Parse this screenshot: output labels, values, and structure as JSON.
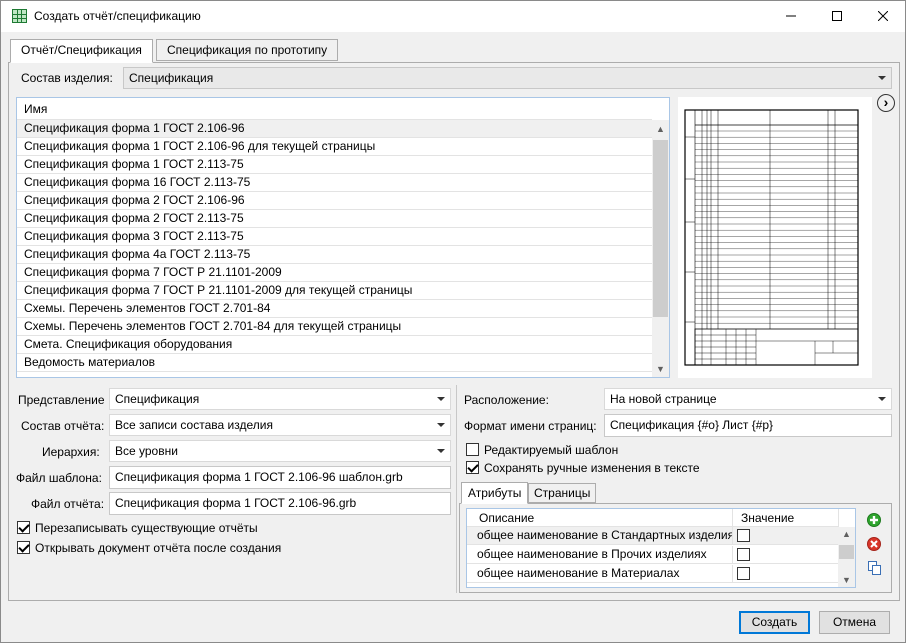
{
  "window": {
    "title": "Создать отчёт/спецификацию",
    "minimize": "—",
    "maximize": "☐",
    "close": "✕"
  },
  "tabs": [
    {
      "label": "Отчёт/Спецификация",
      "active": true
    },
    {
      "label": "Спецификация по прототипу",
      "active": false
    }
  ],
  "composition": {
    "label": "Состав изделия:",
    "value": "Спецификация"
  },
  "templates": {
    "header": "Имя",
    "items": [
      "Спецификация форма 1 ГОСТ 2.106-96",
      "Спецификация форма 1 ГОСТ 2.106-96 для текущей страницы",
      "Спецификация форма 1 ГОСТ 2.113-75",
      "Спецификация форма 16 ГОСТ 2.113-75",
      "Спецификация форма 2 ГОСТ 2.106-96",
      "Спецификация форма 2 ГОСТ 2.113-75",
      "Спецификация форма 3 ГОСТ 2.113-75",
      "Спецификация форма 4а ГОСТ 2.113-75",
      "Спецификация форма 7 ГОСТ  Р 21.1101-2009",
      "Спецификация форма 7 ГОСТ  Р 21.1101-2009 для текущей страницы",
      "Схемы. Перечень элементов ГОСТ 2.701-84",
      "Схемы. Перечень элементов ГОСТ 2.701-84 для текущей страницы",
      "Смета. Спецификация оборудования",
      "Ведомость материалов"
    ],
    "selected_index": 0
  },
  "preview_nav": "›",
  "left_form": {
    "view_label": "Представление",
    "view_value": "Спецификация",
    "report_comp_label": "Состав отчёта:",
    "report_comp_value": "Все записи состава изделия",
    "hierarchy_label": "Иерархия:",
    "hierarchy_value": "Все уровни",
    "template_file_label": "Файл шаблона:",
    "template_file_value": "Спецификация форма 1 ГОСТ 2.106-96 шаблон.grb",
    "report_file_label": "Файл отчёта:",
    "report_file_value": "Спецификация форма 1 ГОСТ 2.106-96.grb",
    "overwrite_label": "Перезаписывать существующие отчёты",
    "overwrite_checked": true,
    "open_after_label": "Открывать документ отчёта после создания",
    "open_after_checked": true
  },
  "right_form": {
    "placement_label": "Расположение:",
    "placement_value": "На новой странице",
    "page_name_label": "Формат имени страниц:",
    "page_name_value": "Спецификация {#o} Лист {#p}",
    "editable_label": "Редактируемый шаблон",
    "editable_checked": false,
    "keep_changes_label": "Сохранять ручные изменения в тексте",
    "keep_changes_checked": true
  },
  "subtabs": [
    {
      "label": "Атрибуты",
      "active": true
    },
    {
      "label": "Страницы",
      "active": false
    }
  ],
  "attributes": {
    "col_desc": "Описание",
    "col_value": "Значение",
    "rows": [
      {
        "desc": "общее наименование в Стандартных изделиях",
        "checked": false
      },
      {
        "desc": "общее наименование в Прочих изделиях",
        "checked": false
      },
      {
        "desc": "общее наименование в Материалах",
        "checked": false
      }
    ]
  },
  "buttons": {
    "create": "Создать",
    "cancel": "Отмена"
  },
  "colors": {
    "add": "#2fa52f",
    "remove": "#d9362a",
    "accent": "#0078d7"
  }
}
